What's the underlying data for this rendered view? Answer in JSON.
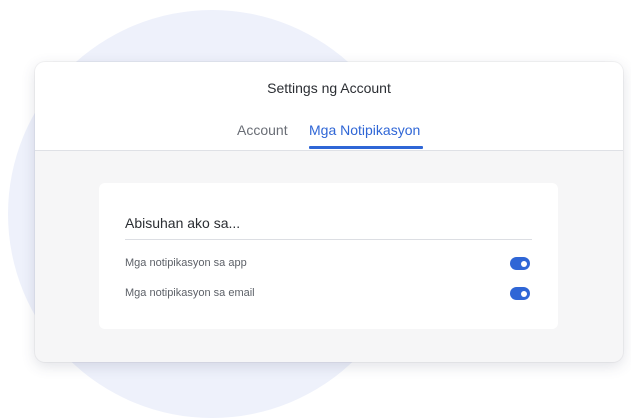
{
  "modal": {
    "title": "Settings ng Account"
  },
  "tabs": [
    {
      "label": "Account",
      "active": false
    },
    {
      "label": "Mga Notipikasyon",
      "active": true
    }
  ],
  "notifications": {
    "heading": "Abisuhan ako sa...",
    "items": [
      {
        "label": "Mga notipikasyon sa app",
        "enabled": true
      },
      {
        "label": "Mga notipikasyon sa email",
        "enabled": true
      }
    ]
  },
  "colors": {
    "accent": "#2f66d6",
    "background_circle": "#eef1fb",
    "modal_body": "#f6f6f7"
  }
}
